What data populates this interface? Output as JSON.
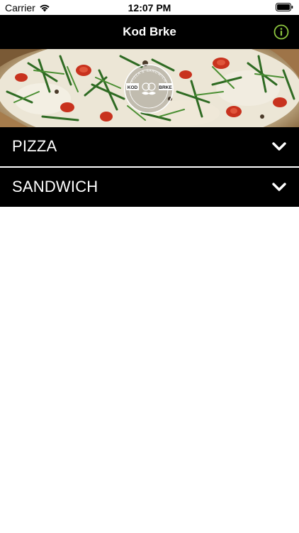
{
  "status_bar": {
    "carrier": "Carrier",
    "time": "12:07 PM",
    "icons": [
      "wifi-icon",
      "battery-icon"
    ]
  },
  "nav": {
    "title": "Kod Brke",
    "info_icon": "info-circle-icon",
    "info_color": "#8dc63f"
  },
  "hero": {
    "image": "pizza-banner-image",
    "logo": {
      "word_left": "KOD",
      "word_right": "BRKE",
      "ring_text": "PIZZA & SANDWICH"
    }
  },
  "menu": {
    "sections": [
      {
        "label": "PIZZA",
        "icon": "chevron-down-icon"
      },
      {
        "label": "SANDWICH",
        "icon": "chevron-down-icon"
      }
    ]
  },
  "colors": {
    "nav_background": "#000000",
    "section_background": "#000000",
    "text": "#ffffff",
    "accent": "#8dc63f"
  }
}
